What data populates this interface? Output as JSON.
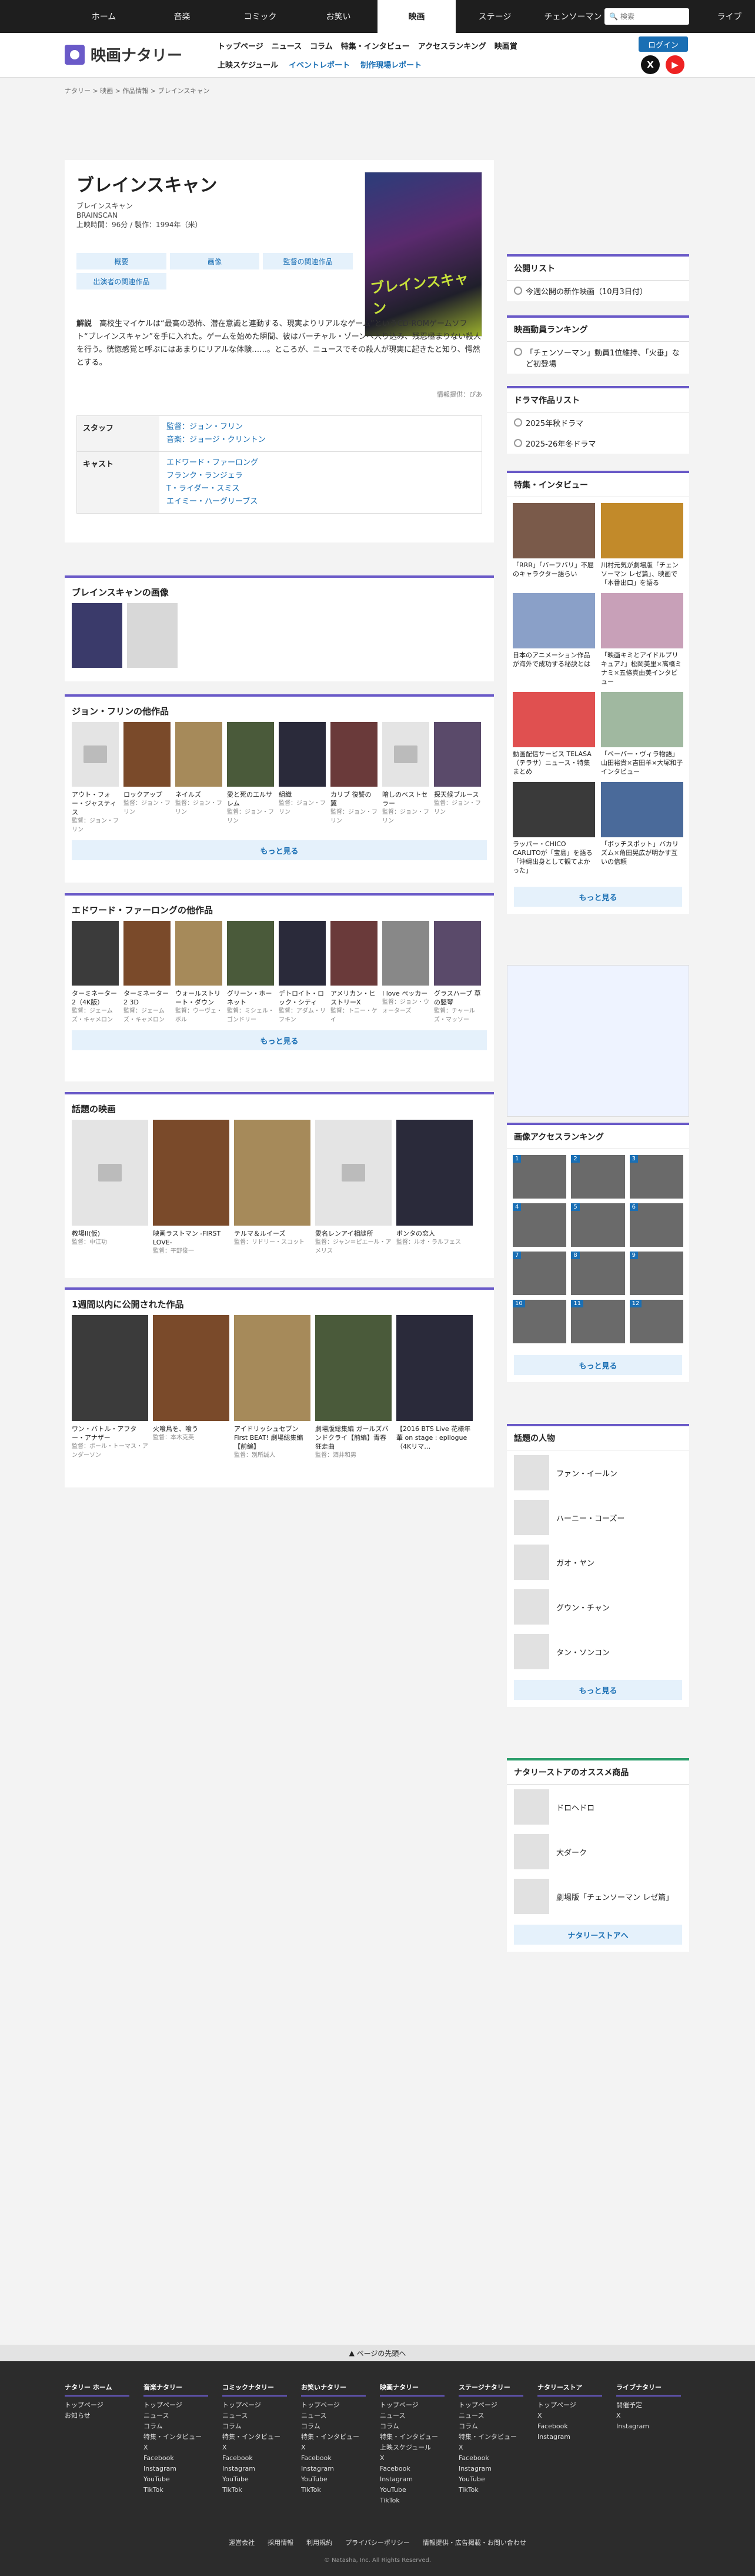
{
  "gnav": {
    "tabs": [
      "ホーム",
      "音楽",
      "コミック",
      "お笑い",
      "映画",
      "ステージ",
      "チェンソーマン",
      "ストア",
      "ライブ"
    ],
    "search_placeholder": "検索"
  },
  "header": {
    "logo": "映画ナタリー",
    "nav1": [
      "トップページ",
      "ニュース",
      "コラム",
      "特集・インタビュー",
      "アクセスランキング",
      "映画賞"
    ],
    "nav2": [
      "上映スケジュール",
      "イベントレポート",
      "制作現場レポート"
    ],
    "login": "ログイン"
  },
  "breadcrumb": "ナタリー > 映画 > 作品情報 > ブレインスキャン",
  "movie": {
    "title": "ブレインスキャン",
    "kana": "ブレインスキャン",
    "en": "BRAINSCAN",
    "meta": "上映時間：96分 / 製作：1994年（米）",
    "poster_title": "ブレインスキャン",
    "buttons": [
      "概要",
      "画像",
      "監督の関連作品",
      "出演者の関連作品"
    ],
    "story_label": "解説",
    "story": "高校生マイケルは“最高の恐怖、潜在意識と連動する、現実よりリアルなゲーム”というCD-ROMゲームソフト“ブレインスキャン”を手に入れた。ゲームを始めた瞬間、彼はバーチャル・ゾーンへ入り込み、残忍極まりない殺人を行う。恍惚感覚と呼ぶにはあまりにリアルな体験……。ところが、ニュースでその殺人が現実に起きたと知り、愕然とする。",
    "credit": "情報提供：ぴあ",
    "staff_label": "スタッフ",
    "director": "監督：ジョン・フリン",
    "music": "音楽：ジョージ・クリントン",
    "cast_label": "キャスト",
    "cast": [
      "エドワード・ファーロング",
      "フランク・ランジェラ",
      "T・ライダー・スミス",
      "エイミー・ハーグリーブス"
    ]
  },
  "images": {
    "title": "ブレインスキャンの画像"
  },
  "director_works": {
    "title": "ジョン・フリンの他作品",
    "items": [
      {
        "n": "アウト・フォー・ジャスティス",
        "d": "監督：ジョン・フリン"
      },
      {
        "n": "ロックアップ",
        "d": "監督：ジョン・フリン"
      },
      {
        "n": "ネイルズ",
        "d": "監督：ジョン・フリン"
      },
      {
        "n": "愛と死のエルサレム",
        "d": "監督：ジョン・フリン"
      },
      {
        "n": "組織",
        "d": "監督：ジョン・フリン"
      },
      {
        "n": "カリブ 復讐の翼",
        "d": "監督：ジョン・フリン"
      },
      {
        "n": "暗しのベストセラー",
        "d": "監督：ジョン・フリン"
      },
      {
        "n": "探天候ブルース",
        "d": "監督：ジョン・フリン"
      }
    ],
    "more": "もっと見る"
  },
  "actor_works": {
    "title": "エドワード・ファーロングの他作品",
    "items": [
      {
        "n": "ターミネーター2（4K版）",
        "d": "監督：ジェームズ・キャメロン"
      },
      {
        "n": "ターミネーター2 3D",
        "d": "監督：ジェームズ・キャメロン"
      },
      {
        "n": "ウォールストリート・ダウン",
        "d": "監督：ウーヴェ・ボル"
      },
      {
        "n": "グリーン・ホーネット",
        "d": "監督：ミシェル・ゴンドリー"
      },
      {
        "n": "デトロイト・ロック・シティ",
        "d": "監督：アダム・リフキン"
      },
      {
        "n": "アメリカン・ヒストリーX",
        "d": "監督：トニー・ケイ"
      },
      {
        "n": "I love ペッカー",
        "d": "監督：ジョン・ウォーターズ"
      },
      {
        "n": "グラスハープ 草の竪琴",
        "d": "監督：チャールズ・マッソー"
      }
    ],
    "more": "もっと見る"
  },
  "hot": {
    "title": "話題の映画",
    "items": [
      {
        "n": "教場II(仮)",
        "d": "監督：中江功"
      },
      {
        "n": "映画ラストマン -FIRST LOVE-",
        "d": "監督：平野俊一"
      },
      {
        "n": "テルマ＆ルイーズ",
        "d": "監督：リドリー・スコット"
      },
      {
        "n": "愛名レンアイ相談所",
        "d": "監督：ジャン＝ピエール・アメリス"
      },
      {
        "n": "ボンタの恋人",
        "d": "監督：ルオ・ラルフェス"
      }
    ]
  },
  "week": {
    "title": "1週間以内に公開された作品",
    "items": [
      {
        "n": "ワン・バトル・アフター・アナザー",
        "d": "監督：ポール・トーマス・アンダーソン"
      },
      {
        "n": "火喰鳥を、喰う",
        "d": "監督：本木克英"
      },
      {
        "n": "アイドリッシュセブン First BEAT! 劇場総集編【前編】",
        "d": "監督：別所誠人"
      },
      {
        "n": "劇場版総集編 ガールズバンドクライ【前編】青春狂走曲",
        "d": "監督：酒井和男"
      },
      {
        "n": "【2016 BTS Live 花様年華 on stage : epilogue（4Kリマ…",
        "d": ""
      }
    ]
  },
  "sidebar": {
    "public_list": {
      "title": "公開リスト",
      "items": [
        "今週公開の新作映画（10月3日付）"
      ]
    },
    "ranking": {
      "title": "映画動員ランキング",
      "items": [
        "「チェンソーマン」動員1位維持、「火垂」など初登場"
      ]
    },
    "drama": {
      "title": "ドラマ作品リスト",
      "items": [
        "2025年秋ドラマ",
        "2025-26年冬ドラマ"
      ]
    },
    "features": {
      "title": "特集・インタビュー",
      "items": [
        "「RRR」「バーフバリ」不屈のキャラクター語らい",
        "川村元気が劇場版「チェンソーマン レゼ篇」、映画で「本番出口」を語る",
        "日本のアニメーション作品が海外で成功する秘訣とは",
        "「映画キミとアイドルプリキュア♪」松岡美里×高橋ミナミ×五條真由美インタビュー",
        "動画配信サービス TELASA（テラサ）ニュース・特集まとめ",
        "「ペーパー・ヴィラ物語」山田裕貴×吉田羊×大塚和子インタビュー",
        "ラッパー・CHICO CARLITOが「宝島」を語る「沖縄出身として観てよかった」",
        "「ボッチスポット」バカリズム×角田晃広が明かす互いの信頼"
      ],
      "more": "もっと見る"
    },
    "img_rank": {
      "title": "画像アクセスランキング",
      "nums": [
        "1",
        "2",
        "3",
        "4",
        "5",
        "6",
        "7",
        "8",
        "9",
        "10",
        "11",
        "12"
      ],
      "more": "もっと見る"
    },
    "people": {
      "title": "話題の人物",
      "items": [
        "ファン・イールン",
        "ハーニー・コーズー",
        "ガオ・ヤン",
        "グウン・チャン",
        "タン・ソンコン"
      ],
      "more": "もっと見る"
    },
    "store": {
      "title": "ナタリーストアのオススメ商品",
      "items": [
        "ドロヘドロ",
        "大ダーク",
        "劇場版「チェンソーマン レゼ篇」"
      ],
      "more": "ナタリーストアへ"
    }
  },
  "footer": {
    "pagetop": "ページの先頭へ",
    "cols": [
      {
        "h": "ナタリー ホーム",
        "l": [
          "トップページ",
          "お知らせ"
        ]
      },
      {
        "h": "音楽ナタリー",
        "l": [
          "トップページ",
          "ニュース",
          "コラム",
          "特集・インタビュー",
          "X",
          "Facebook",
          "Instagram",
          "YouTube",
          "TikTok"
        ]
      },
      {
        "h": "コミックナタリー",
        "l": [
          "トップページ",
          "ニュース",
          "コラム",
          "特集・インタビュー",
          "X",
          "Facebook",
          "Instagram",
          "YouTube",
          "TikTok"
        ]
      },
      {
        "h": "お笑いナタリー",
        "l": [
          "トップページ",
          "ニュース",
          "コラム",
          "特集・インタビュー",
          "X",
          "Facebook",
          "Instagram",
          "YouTube",
          "TikTok"
        ]
      },
      {
        "h": "映画ナタリー",
        "l": [
          "トップページ",
          "ニュース",
          "コラム",
          "特集・インタビュー",
          "上映スケジュール",
          "X",
          "Facebook",
          "Instagram",
          "YouTube",
          "TikTok"
        ]
      },
      {
        "h": "ステージナタリー",
        "l": [
          "トップページ",
          "ニュース",
          "コラム",
          "特集・インタビュー",
          "X",
          "Facebook",
          "Instagram",
          "YouTube",
          "TikTok"
        ]
      },
      {
        "h": "ナタリーストア",
        "l": [
          "トップページ",
          "X",
          "Facebook",
          "Instagram"
        ]
      },
      {
        "h": "ライブナタリー",
        "l": [
          "開催予定",
          "X",
          "Instagram"
        ]
      }
    ],
    "links": [
      "運営会社",
      "採用情報",
      "利用規約",
      "プライバシーポリシー",
      "情報提供・広告掲載・お問い合わせ"
    ],
    "copyright": "© Natasha, Inc. All Rights Reserved."
  }
}
